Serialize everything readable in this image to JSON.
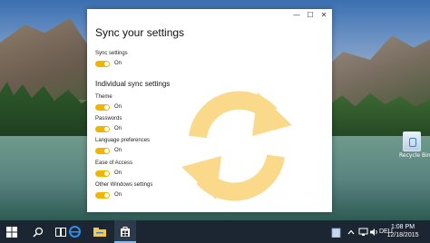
{
  "window": {
    "title_bar": {
      "minimize_glyph": "—",
      "maximize_glyph": "☐",
      "close_glyph": "✕"
    },
    "page_title": "Sync your settings",
    "sync_settings": {
      "label": "Sync settings",
      "state": "On",
      "on": true
    },
    "section_heading": "Individual sync settings",
    "individual_settings": [
      {
        "label": "Theme",
        "state": "On",
        "on": true
      },
      {
        "label": "Passwords",
        "state": "On",
        "on": true
      },
      {
        "label": "Language preferences",
        "state": "On",
        "on": true
      },
      {
        "label": "Ease of Access",
        "state": "On",
        "on": true
      },
      {
        "label": "Other Windows settings",
        "state": "On",
        "on": true
      }
    ],
    "illustration_icon": "sync-arrows-icon"
  },
  "desktop": {
    "icon_label": "Recycle Bin",
    "icon": "recycle-bin-icon"
  },
  "taskbar": {
    "items": [
      "start-icon",
      "search-icon",
      "task-view-icon",
      "edge-icon",
      "file-explorer-icon",
      "store-icon"
    ],
    "tray": {
      "language": "DEU",
      "time": "1:08 PM",
      "date": "12/18/2015"
    }
  },
  "colors": {
    "accent": "#f0b500",
    "illustration": "#fbd98a",
    "taskbar": "#1c2633",
    "window_bg": "#ffffff"
  }
}
